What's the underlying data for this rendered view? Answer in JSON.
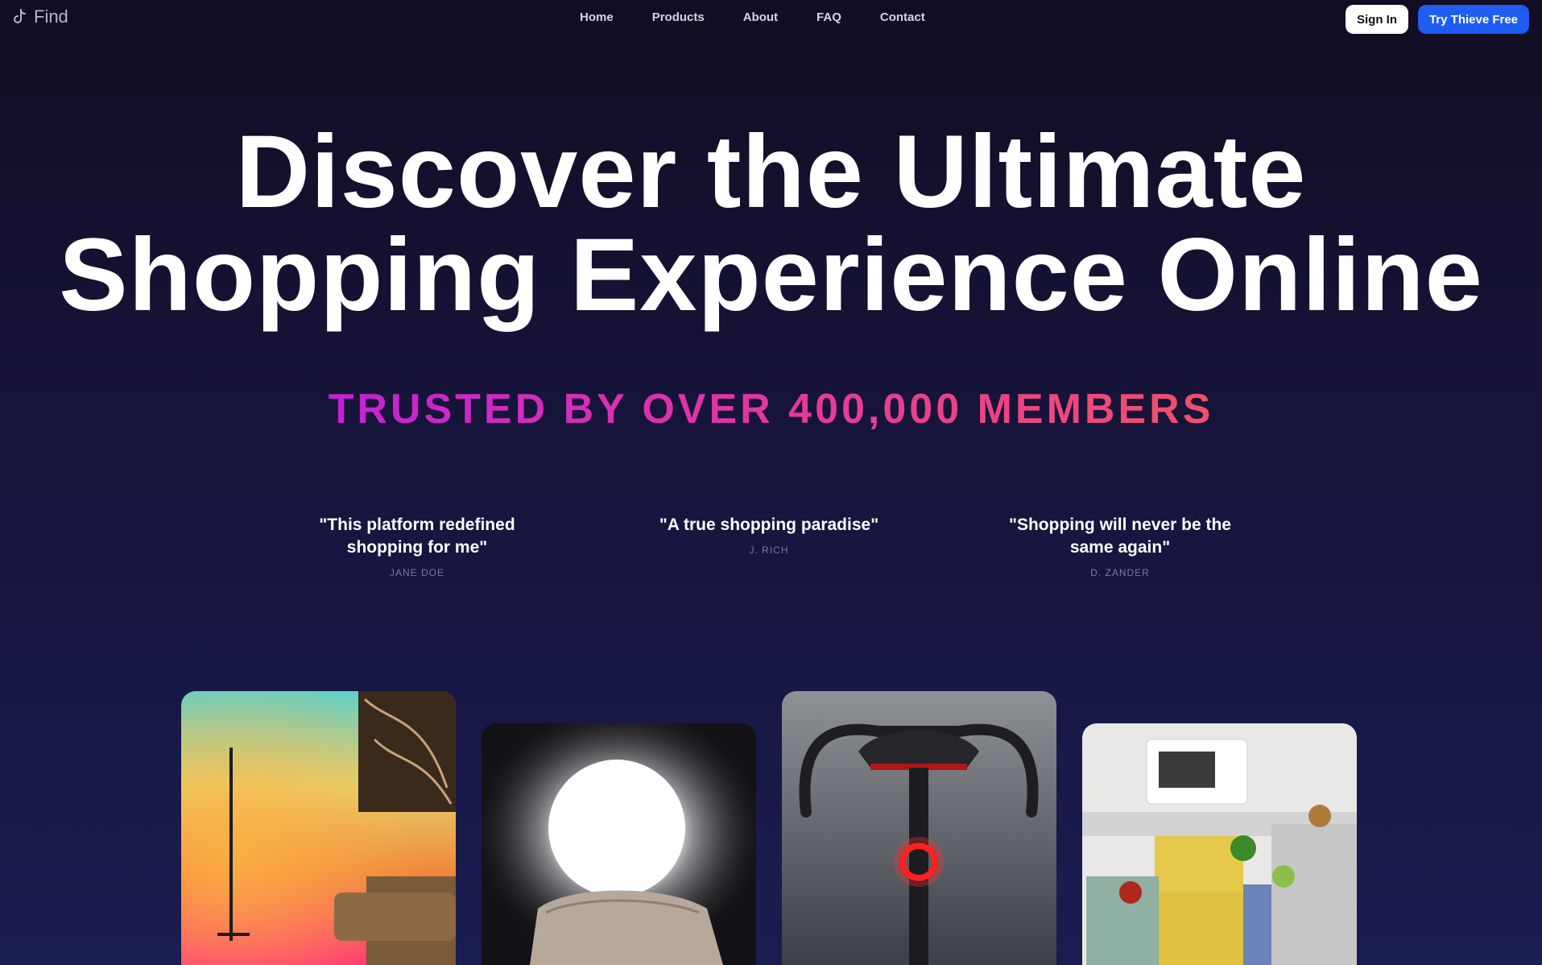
{
  "nav": {
    "logo_text": "Find",
    "links": [
      "Home",
      "Products",
      "About",
      "FAQ",
      "Contact"
    ],
    "signin_label": "Sign In",
    "try_label": "Try Thieve Free"
  },
  "hero": {
    "title_line1": "Discover the Ultimate",
    "title_line2": "Shopping Experience Online",
    "trusted": "TRUSTED BY OVER 400,000 MEMBERS"
  },
  "testimonials": [
    {
      "quote_line1": "\"This platform redefined",
      "quote_line2": "shopping for me\"",
      "author": "JANE DOE"
    },
    {
      "quote_line1": "\"A true shopping paradise\"",
      "quote_line2": "",
      "author": "J. RICH"
    },
    {
      "quote_line1": "\"Shopping will never be the",
      "quote_line2": "same again\"",
      "author": "D. ZANDER"
    }
  ],
  "products": [
    {
      "icon": "rgb-floor-lamp-photo"
    },
    {
      "icon": "glowing-orb-lamp-photo"
    },
    {
      "icon": "bike-tail-light-photo"
    },
    {
      "icon": "folding-crates-photo"
    }
  ],
  "colors": {
    "primary_button": "#1f5cf0",
    "gradient_start": "#c222d6",
    "gradient_end": "#f0506a",
    "background_top": "#120d24",
    "background_bottom": "#1a1d52"
  }
}
